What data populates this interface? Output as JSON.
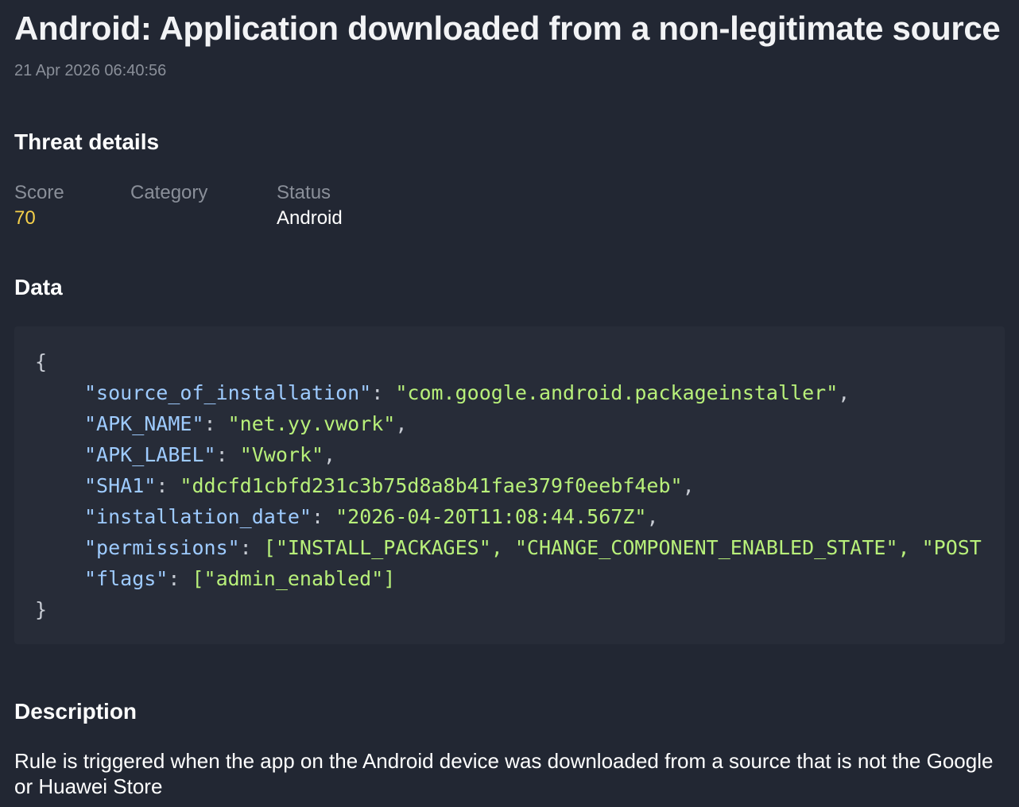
{
  "alert": {
    "title": "Android: Application downloaded from a non-legitimate source",
    "timestamp": "21 Apr 2026 06:40:56"
  },
  "threat_details": {
    "heading": "Threat details",
    "score_label": "Score",
    "score_value": "70",
    "category_label": "Category",
    "category_value": "",
    "status_label": "Status",
    "status_value": "Android"
  },
  "data_section": {
    "heading": "Data",
    "open_brace": "{",
    "close_brace": "}",
    "lines": [
      {
        "key": "\"source_of_installation\"",
        "value": "\"com.google.android.packageinstaller\"",
        "suffix": ","
      },
      {
        "key": "\"APK_NAME\"",
        "value": "\"net.yy.vwork\"",
        "suffix": ","
      },
      {
        "key": "\"APK_LABEL\"",
        "value": "\"Vwork\"",
        "suffix": ","
      },
      {
        "key": "\"SHA1\"",
        "value": "\"ddcfd1cbfd231c3b75d8a8b41fae379f0eebf4eb\"",
        "suffix": ","
      },
      {
        "key": "\"installation_date\"",
        "value": "\"2026-04-20T11:08:44.567Z\"",
        "suffix": ","
      },
      {
        "key": "\"permissions\"",
        "value": "[\"INSTALL_PACKAGES\", \"CHANGE_COMPONENT_ENABLED_STATE\", \"POST",
        "suffix": ""
      },
      {
        "key": "\"flags\"",
        "value": "[\"admin_enabled\"]",
        "suffix": ""
      }
    ]
  },
  "description": {
    "heading": "Description",
    "text": "Rule is triggered when the app on the Android device was downloaded from a source that is not the Google or Huawei Store"
  },
  "colors": {
    "background": "#222733",
    "code_background": "#272c38",
    "json_key": "#9ecbff",
    "json_string": "#b8f07a",
    "score": "#f5d04a",
    "muted_text": "#8a8f99"
  }
}
